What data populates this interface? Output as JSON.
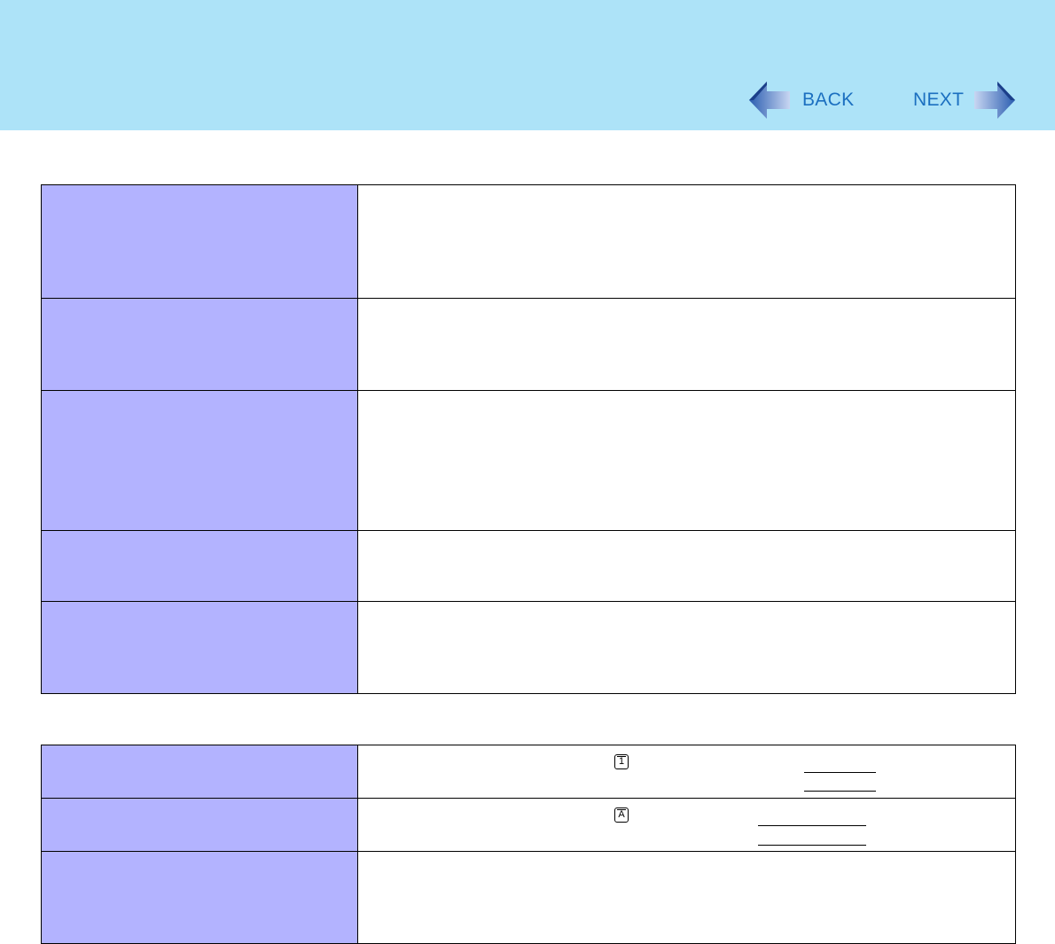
{
  "nav": {
    "back_label": "BACK",
    "next_label": "NEXT",
    "arrow_color": "#1b6fc0"
  },
  "colors": {
    "header_bg": "#ade3f8",
    "label_cell_bg": "#b3b3ff"
  },
  "icons": {
    "row1_key": "1",
    "row2_key": "A"
  }
}
